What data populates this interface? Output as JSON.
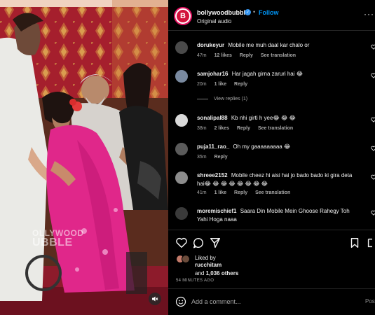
{
  "media": {
    "watermark_line1": "OLLYWOOD",
    "watermark_line2": "UBBLE"
  },
  "header": {
    "username": "bollywoodbubble",
    "dot": "•",
    "follow_label": "Follow",
    "audio": "Original audio",
    "more": "···",
    "avatar_letter": "B"
  },
  "comments": [
    {
      "username": "dorukeyur",
      "text": "Mobile me muh daal kar chalo or",
      "time": "47m",
      "likes": "12 likes",
      "reply": "Reply",
      "translate": "See translation",
      "avatar_color": "#4a4a4a"
    },
    {
      "username": "samjohar16",
      "text": "Har jagah girna zaruri hai 😂",
      "time": "20m",
      "likes": "1 like",
      "reply": "Reply",
      "translate": "",
      "avatar_color": "#7a8aa0"
    },
    {
      "username": "sonalipal88",
      "text": "Kb nhi girti h yee😂 😂 😂",
      "time": "38m",
      "likes": "2 likes",
      "reply": "Reply",
      "translate": "See translation",
      "avatar_color": "#d9d9d9"
    },
    {
      "username": "puja11_rao_",
      "text": "Oh my gaaaaaaaaa 😂",
      "time": "35m",
      "likes": "",
      "reply": "Reply",
      "translate": "",
      "avatar_color": "#5b5b5b"
    },
    {
      "username": "shreee2152",
      "text": "Mobile cheez hi aisi hai jo bado bado ki gira deta hai😂 😂 😂 😂 😂 😂 😂 😂",
      "time": "41m",
      "likes": "1 like",
      "reply": "Reply",
      "translate": "See translation",
      "avatar_color": "#8c8c8c"
    },
    {
      "username": "moremischief1",
      "text": "Saara Din Mobile Mein Ghoose Rahegy Toh Yahi Hoga naaa",
      "time": "",
      "likes": "",
      "reply": "",
      "translate": "",
      "avatar_color": "#3a3a3a"
    }
  ],
  "view_replies": "View replies (1)",
  "liked": {
    "label": "Liked by",
    "user": "rucchitam",
    "and_prefix": "and",
    "others": "1,036 others"
  },
  "timestamp": "54 MINUTES AGO",
  "add_comment": {
    "placeholder": "Add a comment...",
    "post_label": "Post"
  },
  "colors": {
    "accent": "#0095f6",
    "brand": "#d3123c",
    "saree": "#e0278a"
  }
}
